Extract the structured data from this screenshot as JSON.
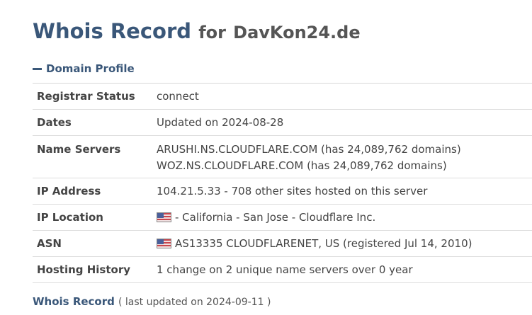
{
  "header": {
    "title": "Whois Record",
    "connector": "for",
    "domain": "DavKon24.de"
  },
  "profile": {
    "section_label": "Domain Profile",
    "rows": [
      {
        "label": "Registrar Status",
        "value": "connect"
      },
      {
        "label": "Dates",
        "value": "Updated on 2024-08-28"
      },
      {
        "label": "Name Servers",
        "values": [
          "ARUSHI.NS.CLOUDFLARE.COM (has 24,089,762 domains)",
          "WOZ.NS.CLOUDFLARE.COM (has 24,089,762 domains)"
        ]
      },
      {
        "label": "IP Address",
        "value": "104.21.5.33 - 708 other sites hosted on this server"
      },
      {
        "label": "IP Location",
        "value": "- California - San Jose - Cloudflare Inc.",
        "icon": "us-flag-icon"
      },
      {
        "label": "ASN",
        "value": "AS13335 CLOUDFLARENET, US (registered Jul 14, 2010)",
        "icon": "us-flag-icon"
      },
      {
        "label": "Hosting History",
        "value": "1 change on 2 unique name servers over 0 year"
      }
    ]
  },
  "footer": {
    "link_label": "Whois Record",
    "note": "( last updated on 2024-09-11 )"
  },
  "colors": {
    "accent": "#3a5779",
    "text": "#444444",
    "divider": "#dddddd"
  }
}
